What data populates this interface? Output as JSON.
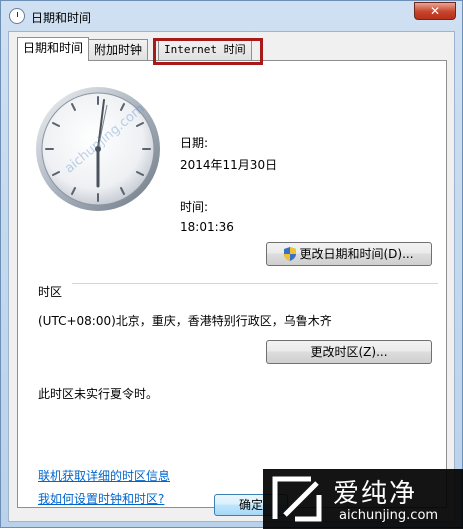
{
  "window": {
    "title": "日期和时间",
    "close_glyph": "✕"
  },
  "tabs": [
    {
      "label": "日期和时间",
      "active": true
    },
    {
      "label": "附加时钟",
      "active": false
    },
    {
      "label": "Internet 时间",
      "active": false
    }
  ],
  "date_section": {
    "date_label": "日期:",
    "date_value": "2014年11月30日",
    "time_label": "时间:",
    "time_value": "18:01:36",
    "change_button": "更改日期和时间(D)..."
  },
  "timezone_section": {
    "heading": "时区",
    "value": "(UTC+08:00)北京，重庆，香港特别行政区，乌鲁木齐",
    "change_button": "更改时区(Z)...",
    "dst_note": "此时区未实行夏令时。"
  },
  "links": {
    "online_info": "联机获取详细的时区信息",
    "how_to": "我如何设置时钟和时区?"
  },
  "footer": {
    "ok_button": "确定"
  },
  "watermark": {
    "brand_cn": "爱纯净",
    "brand_url": "aichunjing.com",
    "overlay_text": "aichunjing.com"
  },
  "colors": {
    "link": "#0066cc",
    "highlight_box": "#a81919",
    "title_bar": "#b9d1ea"
  }
}
